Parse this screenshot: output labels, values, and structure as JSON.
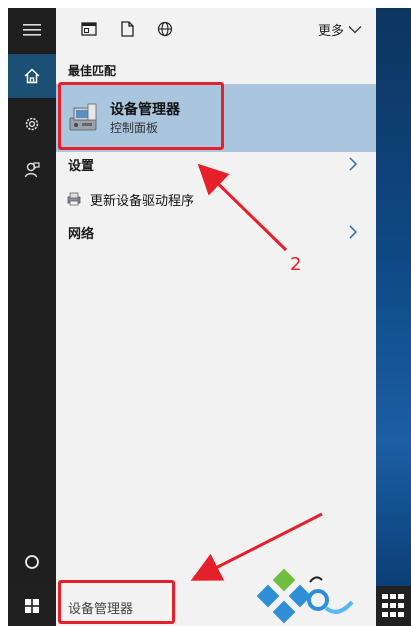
{
  "header": {
    "more_label": "更多"
  },
  "sections": {
    "best_match_label": "最佳匹配",
    "settings_label": "设置",
    "network_label": "网络"
  },
  "best_match": {
    "title": "设备管理器",
    "subtitle": "控制面板"
  },
  "settings_items": [
    {
      "label": "更新设备驱动程序"
    }
  ],
  "search": {
    "query": "设备管理器"
  },
  "annotations": {
    "step_number": "2"
  },
  "colors": {
    "accent_red": "#e5202a",
    "selection_blue": "#a9c6de",
    "rail_dark": "#1f1f1f",
    "active_blue": "#1b4f74"
  }
}
